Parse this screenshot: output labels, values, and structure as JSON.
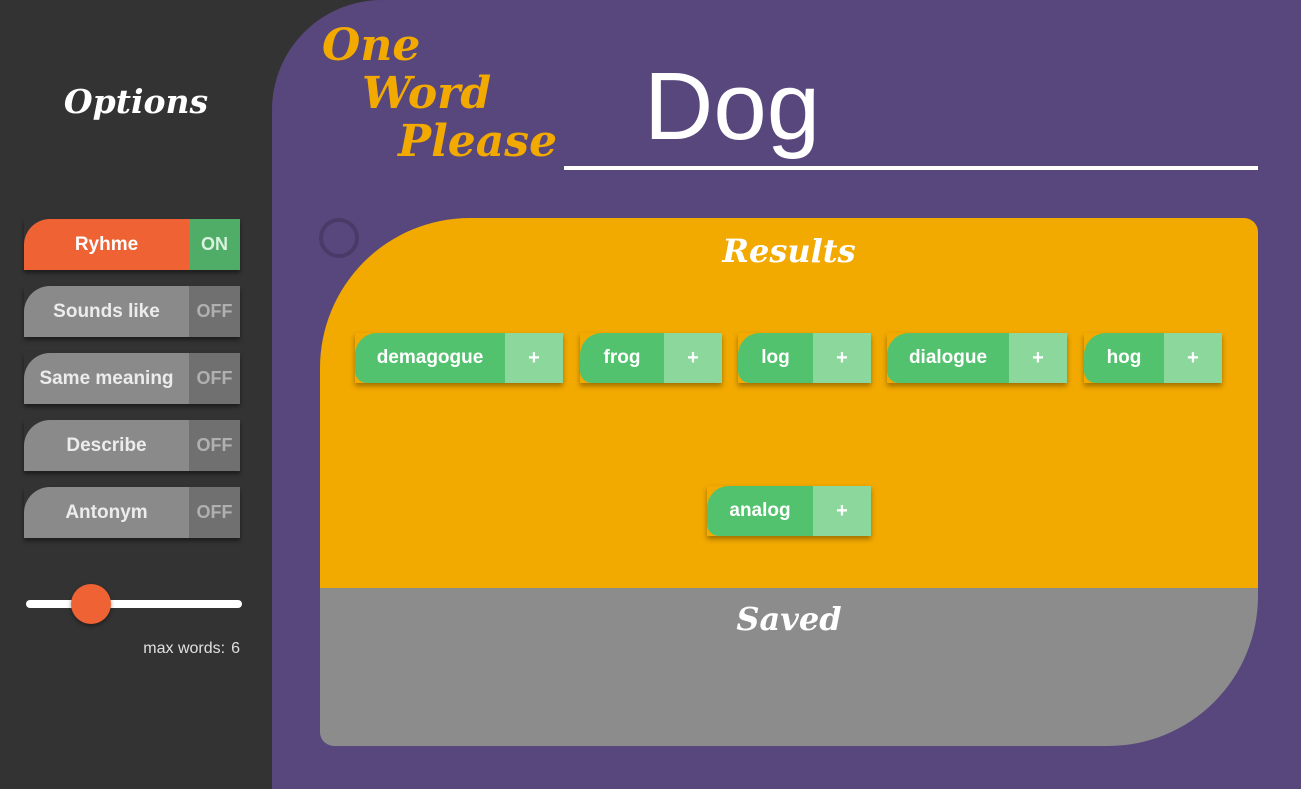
{
  "sidebar": {
    "title": "Options",
    "options": [
      {
        "label": "Ryhme",
        "state": "ON"
      },
      {
        "label": "Sounds like",
        "state": "OFF"
      },
      {
        "label": "Same meaning",
        "state": "OFF"
      },
      {
        "label": "Describe",
        "state": "OFF"
      },
      {
        "label": "Antonym",
        "state": "OFF"
      }
    ],
    "slider": {
      "value": 6,
      "max": 20,
      "label": "max words:",
      "value_text": "6"
    }
  },
  "header": {
    "logo_line1": "One",
    "logo_line2": "Word",
    "logo_line3": "Please",
    "search_value": "Dog"
  },
  "results": {
    "title": "Results",
    "words": [
      {
        "label": "demagogue",
        "add": "+"
      },
      {
        "label": "frog",
        "add": "+"
      },
      {
        "label": "log",
        "add": "+"
      },
      {
        "label": "dialogue",
        "add": "+"
      },
      {
        "label": "hog",
        "add": "+"
      },
      {
        "label": "analog",
        "add": "+"
      }
    ]
  },
  "saved": {
    "title": "Saved"
  },
  "colors": {
    "sidebar_bg": "#333333",
    "main_bg": "#58477c",
    "accent_orange": "#ee6233",
    "results_bg": "#f2a900",
    "saved_bg": "#8c8c8c",
    "word_green": "#53c26e",
    "on_green": "#4fad68"
  }
}
